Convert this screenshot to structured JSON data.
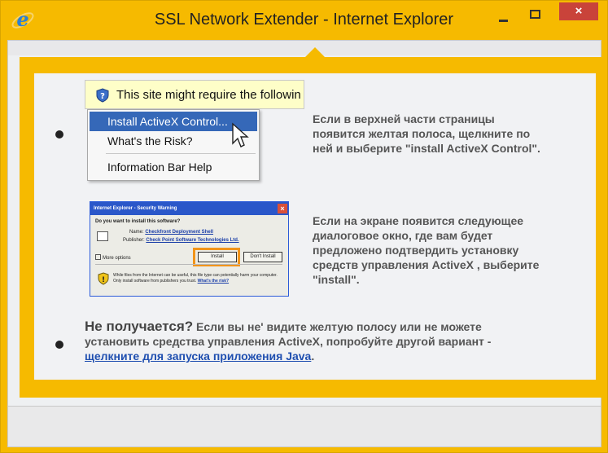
{
  "window": {
    "title": "SSL Network Extender - Internet Explorer",
    "close_glyph": "×",
    "accent_color": "#f6ba00"
  },
  "step1": {
    "infobar_text": "This site might require the followin",
    "menu": [
      "Install ActiveX Control...",
      "What's the Risk?",
      "Information Bar Help"
    ],
    "instruction_lines": [
      "Если в верхней части страницы",
      "появится желтая полоса, щелкните по",
      "ней и выберите \"install ActiveX Control\"."
    ]
  },
  "step2": {
    "dialog": {
      "title": "Internet Explorer - Security Warning",
      "question": "Do you want to install this software?",
      "name_label": "Name:",
      "name_value": "Checkfront Deployment Shell",
      "publisher_label": "Publisher:",
      "publisher_value": "Check Point Software Technologies Ltd.",
      "more_options": "More options",
      "install_button": "Install",
      "dont_install_button": "Don't Install",
      "warning_text": "While files from the Internet can be useful, this file type can potentially harm your computer. Only install software from publishers you trust.",
      "risk_link": "What's the risk?"
    },
    "instruction_lines": [
      "Если на экране появится следующее",
      "диалоговое окно, где вам будет",
      "предложено подтвердить установку",
      "средств управления ActiveX , выберите",
      "\"install\"."
    ]
  },
  "step3": {
    "lead": "Не получается?",
    "text_line1": " Если вы не' видите желтую полосу или не можете",
    "text_line2": "установить средства управления ActiveX, попробуйте другой вариант -",
    "link": "щелкните для запуска приложения Java",
    "tail": "."
  },
  "icons": {
    "browser": "internet-explorer-icon",
    "shield": "shield-question-icon",
    "cursor": "mouse-pointer-icon"
  }
}
